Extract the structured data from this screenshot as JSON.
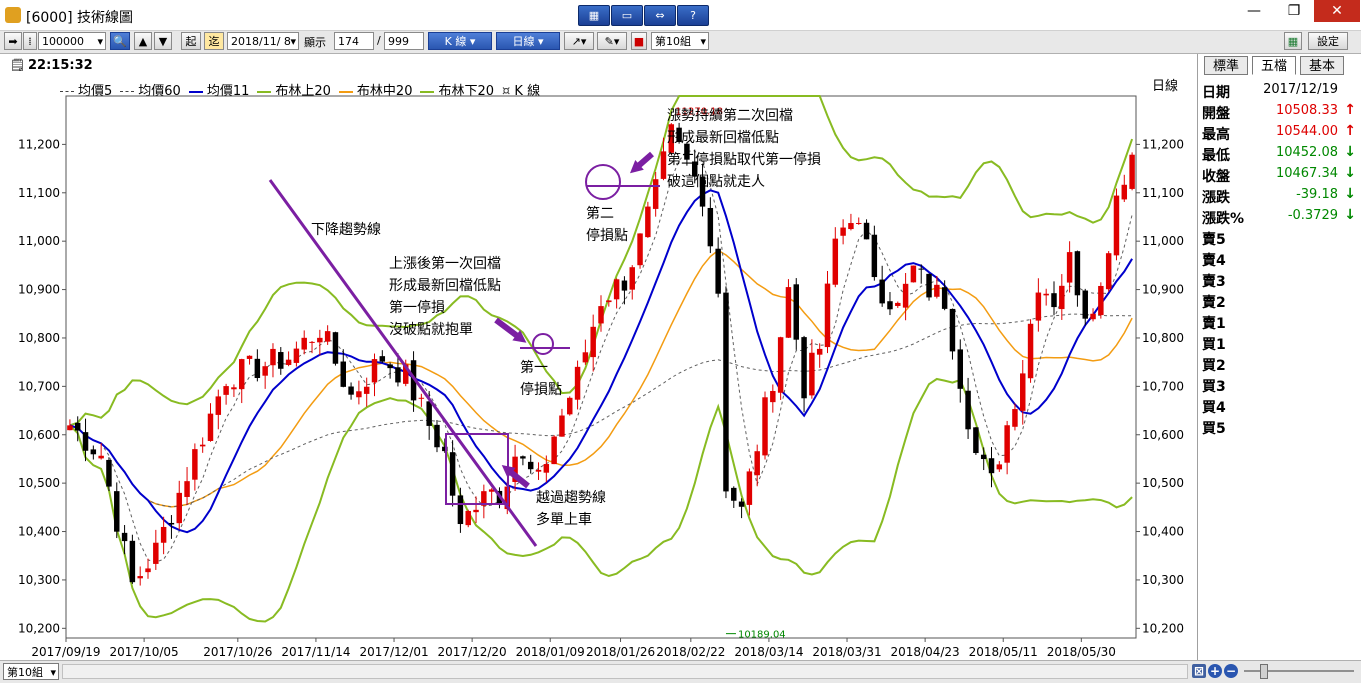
{
  "window": {
    "title": "[6000] 技術線圖",
    "minimize_glyph": "—",
    "restore_glyph": "❐",
    "close_glyph": "✕"
  },
  "toolbar": {
    "symbol": "100000",
    "start_label": "起",
    "continue_label": "迄",
    "date": "2018/11/ 8",
    "display_label": "顯示",
    "display_count": "174",
    "slash": "/",
    "display_total": "999",
    "kline_menu": "K 線 ▾",
    "period_menu": "日線 ▾",
    "group": "第10組",
    "settings_label": "設定"
  },
  "timebar": {
    "time": "22:15:32"
  },
  "legend": [
    {
      "label": "均價5",
      "color": "#404040",
      "dash": true
    },
    {
      "label": "均價60",
      "color": "#404040",
      "dash": true
    },
    {
      "label": "均價11",
      "color": "#0000cc",
      "dash": false
    },
    {
      "label": "布林上20",
      "color": "#88bb22",
      "dash": false
    },
    {
      "label": "布林中20",
      "color": "#f39c12",
      "dash": false
    },
    {
      "label": "布林下20",
      "color": "#88bb22",
      "dash": false
    },
    {
      "label": "K 線",
      "color": "#404040",
      "icon": true
    }
  ],
  "right_panel": {
    "tabs": [
      "標準",
      "五檔",
      "基本"
    ],
    "active_tab": 1,
    "quote": [
      {
        "k": "日期",
        "v": "2017/12/19",
        "color": "#000000",
        "arrow": ""
      },
      {
        "k": "開盤",
        "v": "10508.33",
        "color": "#dd0000",
        "arrow": "↑"
      },
      {
        "k": "最高",
        "v": "10544.00",
        "color": "#dd0000",
        "arrow": "↑"
      },
      {
        "k": "最低",
        "v": "10452.08",
        "color": "#008800",
        "arrow": "↓"
      },
      {
        "k": "收盤",
        "v": "10467.34",
        "color": "#008800",
        "arrow": "↓"
      },
      {
        "k": "漲跌",
        "v": "-39.18",
        "color": "#008800",
        "arrow": "↓"
      },
      {
        "k": "漲跌%",
        "v": "-0.3729",
        "color": "#008800",
        "arrow": "↓"
      },
      {
        "k": "賣5",
        "v": "",
        "color": "#000000",
        "arrow": ""
      },
      {
        "k": "賣4",
        "v": "",
        "color": "#000000",
        "arrow": ""
      },
      {
        "k": "賣3",
        "v": "",
        "color": "#000000",
        "arrow": ""
      },
      {
        "k": "賣2",
        "v": "",
        "color": "#000000",
        "arrow": ""
      },
      {
        "k": "賣1",
        "v": "",
        "color": "#000000",
        "arrow": ""
      },
      {
        "k": "買1",
        "v": "",
        "color": "#000000",
        "arrow": ""
      },
      {
        "k": "買2",
        "v": "",
        "color": "#000000",
        "arrow": ""
      },
      {
        "k": "買3",
        "v": "",
        "color": "#000000",
        "arrow": ""
      },
      {
        "k": "買4",
        "v": "",
        "color": "#000000",
        "arrow": ""
      },
      {
        "k": "買5",
        "v": "",
        "color": "#000000",
        "arrow": ""
      }
    ]
  },
  "bottombar": {
    "group": "第10組"
  },
  "chart_data": {
    "type": "candlestick",
    "period_label": "日線",
    "ylim": [
      10180,
      11300
    ],
    "y_ticks": [
      10200,
      10300,
      10400,
      10500,
      10600,
      10700,
      10800,
      10900,
      11000,
      11100,
      11200
    ],
    "y_tick_labels": [
      "10,200",
      "10,300",
      "10,400",
      "10,500",
      "10,600",
      "10,700",
      "10,800",
      "10,900",
      "11,000",
      "11,100",
      "11,200"
    ],
    "x_tick_labels": [
      "2017/09/19",
      "2017/10/05",
      "2017/10/26",
      "2017/11/14",
      "2017/12/01",
      "2017/12/20",
      "2018/01/09",
      "2018/01/26",
      "2018/02/22",
      "2018/03/14",
      "2018/03/31",
      "2018/04/23",
      "2018/05/11",
      "2018/05/30"
    ],
    "x_tick_index": [
      0,
      10,
      22,
      32,
      42,
      52,
      62,
      71,
      80,
      90,
      100,
      110,
      120,
      130
    ],
    "n_bars": 137,
    "candle_keypoints": [
      [
        0,
        10620
      ],
      [
        4,
        10560
      ],
      [
        8,
        10290
      ],
      [
        11,
        10360
      ],
      [
        14,
        10480
      ],
      [
        17,
        10600
      ],
      [
        20,
        10720
      ],
      [
        24,
        10740
      ],
      [
        28,
        10760
      ],
      [
        32,
        10820
      ],
      [
        36,
        10680
      ],
      [
        40,
        10760
      ],
      [
        43,
        10720
      ],
      [
        46,
        10620
      ],
      [
        48,
        10560
      ],
      [
        50,
        10400
      ],
      [
        53,
        10500
      ],
      [
        55,
        10480
      ],
      [
        57,
        10560
      ],
      [
        60,
        10500
      ],
      [
        62,
        10600
      ],
      [
        65,
        10720
      ],
      [
        68,
        10880
      ],
      [
        71,
        10920
      ],
      [
        73,
        11000
      ],
      [
        75,
        11100
      ],
      [
        77,
        11220
      ],
      [
        79,
        11160
      ],
      [
        81,
        11100
      ],
      [
        83,
        10900
      ],
      [
        84,
        10500
      ],
      [
        86,
        10440
      ],
      [
        88,
        10580
      ],
      [
        90,
        10720
      ],
      [
        92,
        10900
      ],
      [
        94,
        10700
      ],
      [
        96,
        10780
      ],
      [
        98,
        11000
      ],
      [
        100,
        11060
      ],
      [
        102,
        10980
      ],
      [
        104,
        10900
      ],
      [
        106,
        10860
      ],
      [
        108,
        10940
      ],
      [
        110,
        10900
      ],
      [
        112,
        10880
      ],
      [
        114,
        10720
      ],
      [
        116,
        10560
      ],
      [
        118,
        10500
      ],
      [
        120,
        10620
      ],
      [
        122,
        10740
      ],
      [
        124,
        10920
      ],
      [
        126,
        10880
      ],
      [
        128,
        10960
      ],
      [
        130,
        10860
      ],
      [
        132,
        10900
      ],
      [
        134,
        11100
      ],
      [
        136,
        11180
      ]
    ],
    "extremes": {
      "high": "11270.18",
      "low": "10189.04"
    },
    "annotations": [
      {
        "id": "downtrend",
        "lines": [
          "下降趨勢線"
        ]
      },
      {
        "id": "first_stop",
        "lines": [
          "上漲後第一次回檔",
          "形成最新回檔低點",
          "第一停損",
          "沒破點就抱單"
        ]
      },
      {
        "id": "first_stop_label",
        "lines": [
          "第一",
          "停損點"
        ]
      },
      {
        "id": "second_stop",
        "lines": [
          "漲勢持續第二次回檔",
          "形成最新回檔低點",
          "第二停損點取代第一停損",
          "破這個點就走人"
        ]
      },
      {
        "id": "second_stop_label",
        "lines": [
          "第二",
          "停損點"
        ]
      },
      {
        "id": "breakout",
        "lines": [
          "越過趨勢線",
          "多單上車"
        ]
      }
    ]
  }
}
